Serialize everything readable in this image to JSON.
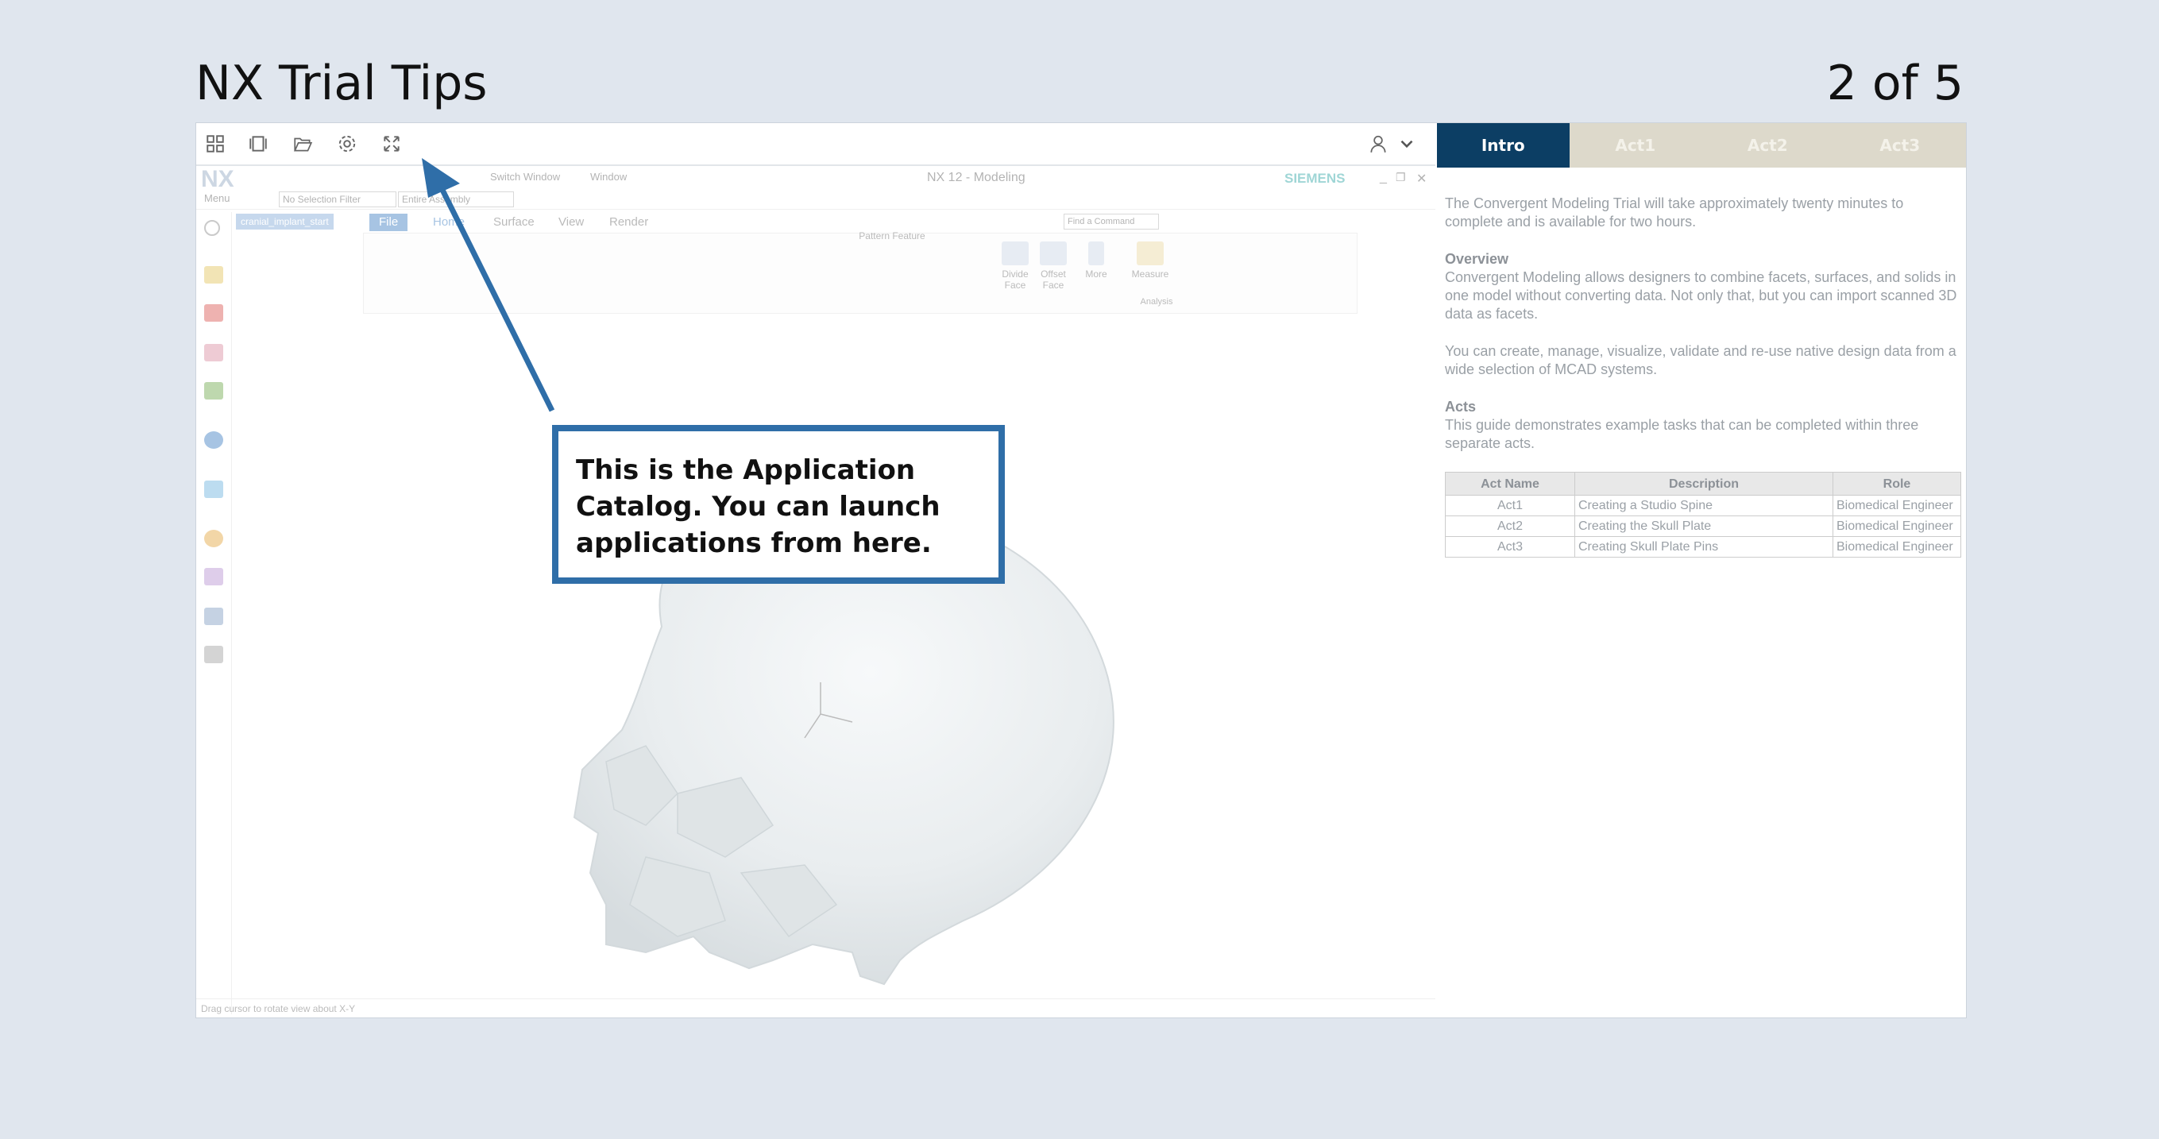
{
  "slide": {
    "title": "NX Trial Tips",
    "counter": "2 of 5"
  },
  "launcher": {
    "buttons": [
      "app-catalog-icon",
      "windows-icon",
      "folder-open-icon",
      "settings-gear-icon",
      "fullscreen-expand-icon"
    ],
    "user_icon": "user-icon",
    "dropdown_icon": "chevron-down-icon"
  },
  "nx": {
    "logo": "NX",
    "title": "NX 12 - Modeling",
    "brand": "SIEMENS",
    "switch_window": "Switch Window",
    "window": "Window",
    "menu": "Menu",
    "selection_filter": "No Selection Filter",
    "assembly_scope": "Entire Assembly",
    "part_tab": "cranial_implant_start",
    "ribbon_tabs": [
      "File",
      "Home",
      "Surface",
      "View",
      "Render"
    ],
    "find_command_placeholder": "Find a Command",
    "pattern_feature": "Pattern Feature",
    "ribbon_buttons": [
      {
        "label": "Divide Face"
      },
      {
        "label": "Offset Face"
      },
      {
        "label": "More"
      },
      {
        "label": "Measure"
      }
    ],
    "analysis_group": "Analysis",
    "status": "Drag cursor to rotate view about X-Y"
  },
  "callout": {
    "text": "This is the Application Catalog. You can launch applications from here."
  },
  "panel": {
    "tabs": [
      "Intro",
      "Act1",
      "Act2",
      "Act3"
    ],
    "active_tab": "Intro",
    "intro": "The Convergent Modeling Trial will take approximately twenty minutes to complete and is available for two hours.",
    "overview_heading": "Overview",
    "overview_p1": "Convergent Modeling allows designers to combine facets, surfaces, and solids in one model without converting data. Not only that, but you can import scanned 3D data as facets.",
    "overview_p2": "You can create, manage, visualize, validate and re-use native design data from a wide selection of MCAD systems.",
    "acts_heading": "Acts",
    "acts_p": "This guide demonstrates example tasks that can be completed within three separate acts.",
    "table": {
      "headers": [
        "Act Name",
        "Description",
        "Role"
      ],
      "rows": [
        [
          "Act1",
          "Creating a Studio Spine",
          "Biomedical Engineer"
        ],
        [
          "Act2",
          "Creating the Skull Plate",
          "Biomedical Engineer"
        ],
        [
          "Act3",
          "Creating Skull Plate Pins",
          "Biomedical Engineer"
        ]
      ]
    }
  },
  "colors": {
    "accent": "#2f6ea8",
    "active_tab": "#0c3e64",
    "inactive_tab": "#ddd9cb",
    "background": "#e0e6ee"
  }
}
